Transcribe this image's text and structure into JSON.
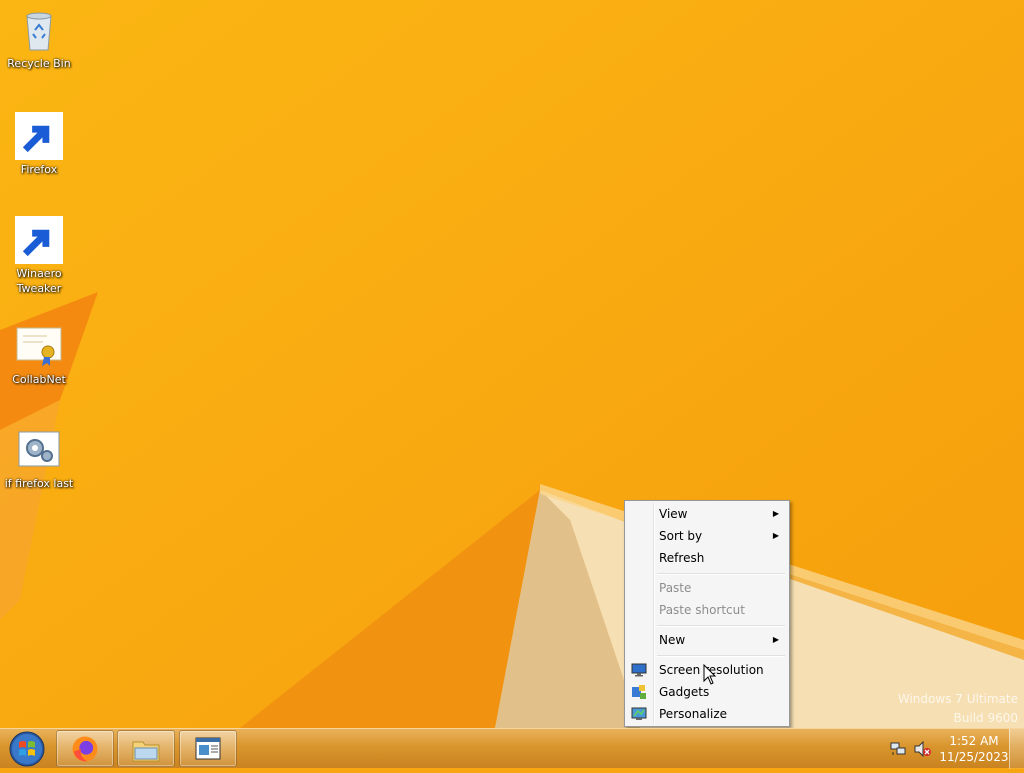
{
  "desktop": {
    "icons": [
      {
        "label": "Recycle Bin",
        "icon": "recycle-bin-icon"
      },
      {
        "label": "Firefox",
        "icon": "firefox-icon"
      },
      {
        "label": "Winaero\nTweaker",
        "icon": "winaero-tweaker-icon"
      },
      {
        "label": "CollabNet",
        "icon": "certificate-icon"
      },
      {
        "label": "if firefox last",
        "icon": "script-gear-icon"
      }
    ],
    "watermark": {
      "line1": "Windows 7 Ultimate",
      "line2": "Build 9600"
    }
  },
  "context_menu": {
    "items": [
      {
        "label": "View",
        "submenu": true,
        "enabled": true
      },
      {
        "label": "Sort by",
        "submenu": true,
        "enabled": true
      },
      {
        "label": "Refresh",
        "submenu": false,
        "enabled": true
      },
      {
        "label": "Paste",
        "submenu": false,
        "enabled": false
      },
      {
        "label": "Paste shortcut",
        "submenu": false,
        "enabled": false
      },
      {
        "label": "New",
        "submenu": true,
        "enabled": true
      },
      {
        "label": "Screen resolution",
        "submenu": false,
        "enabled": true,
        "icon": "monitor-icon"
      },
      {
        "label": "Gadgets",
        "submenu": false,
        "enabled": true,
        "icon": "gadgets-icon"
      },
      {
        "label": "Personalize",
        "submenu": false,
        "enabled": true,
        "icon": "personalize-icon"
      }
    ]
  },
  "taskbar": {
    "pinned": [
      {
        "name": "Firefox",
        "icon": "firefox-icon"
      },
      {
        "name": "File Explorer",
        "icon": "folder-icon"
      },
      {
        "name": "Window",
        "icon": "window-icon"
      }
    ],
    "clock": {
      "time": "1:52 AM",
      "date": "11/25/2023"
    },
    "tray": [
      "network-icon",
      "volume-muted-icon"
    ]
  },
  "colors": {
    "accent": "#f7a510",
    "taskbar": "#d9952d",
    "menu_bg": "#f5f5f5"
  }
}
